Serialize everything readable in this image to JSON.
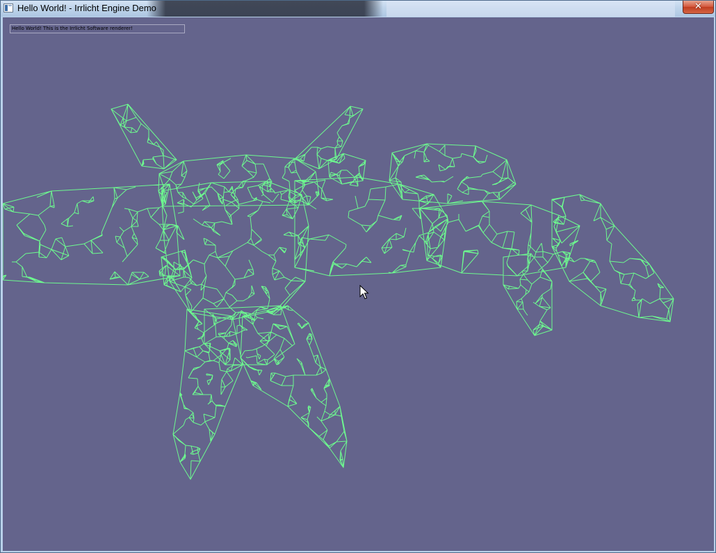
{
  "window": {
    "title": "Hello World! - Irrlicht Engine Demo",
    "close_glyph": "✕",
    "icon": "window-app-icon"
  },
  "scene": {
    "static_text": "Hello World! This is the Irrlicht Software renderer!",
    "background_color": "#64648c",
    "wireframe_color": "#6dfa8f",
    "model": "wireframe-mech-model"
  },
  "cursor": {
    "icon": "arrow-cursor-icon"
  }
}
